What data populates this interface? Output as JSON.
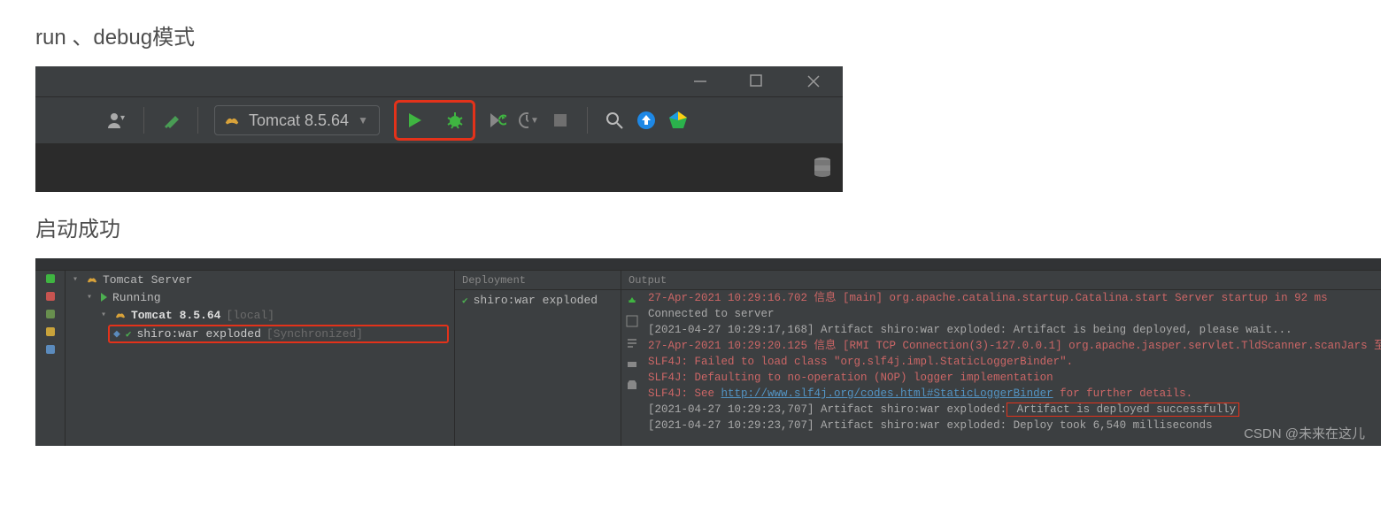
{
  "headings": {
    "run_debug": "run 、debug模式",
    "start_ok": "启动成功"
  },
  "toolbar": {
    "config_label": "Tomcat 8.5.64"
  },
  "tree": {
    "root": "Tomcat Server",
    "running": "Running",
    "node": "Tomcat 8.5.64",
    "node_suffix": "[local]",
    "artifact": "shiro:war exploded",
    "artifact_suffix": "[Synchronized]"
  },
  "deployment": {
    "header": "Deployment",
    "item": "shiro:war exploded"
  },
  "output": {
    "header": "Output",
    "lines": [
      {
        "cls": "c-red",
        "text": "27-Apr-2021 10:29:16.702 信息 [main] org.apache.catalina.startup.Catalina.start Server startup in 92 ms"
      },
      {
        "cls": "c-gray",
        "text": "Connected to server"
      },
      {
        "cls": "c-gray",
        "text": "[2021-04-27 10:29:17,168] Artifact shiro:war exploded: Artifact is being deployed, please wait..."
      },
      {
        "cls": "c-red",
        "text": "27-Apr-2021 10:29:20.125 信息 [RMI TCP Connection(3)-127.0.0.1] org.apache.jasper.servlet.TldScanner.scanJars 至少有一个JAR被扫描用于"
      },
      {
        "cls": "c-red",
        "text": "SLF4J: Failed to load class \"org.slf4j.impl.StaticLoggerBinder\"."
      },
      {
        "cls": "c-red",
        "text": "SLF4J: Defaulting to no-operation (NOP) logger implementation"
      }
    ],
    "slf4j_prefix": "SLF4J: See ",
    "slf4j_link": "http://www.slf4j.org/codes.html#StaticLoggerBinder",
    "slf4j_suffix": " for further details.",
    "success_prefix": "[2021-04-27 10:29:23,707] Artifact shiro:war exploded:",
    "success_msg": " Artifact is deployed successfully",
    "last_line": "[2021-04-27 10:29:23,707] Artifact shiro:war exploded: Deploy took 6,540 milliseconds"
  },
  "watermark": "CSDN @未来在这儿"
}
